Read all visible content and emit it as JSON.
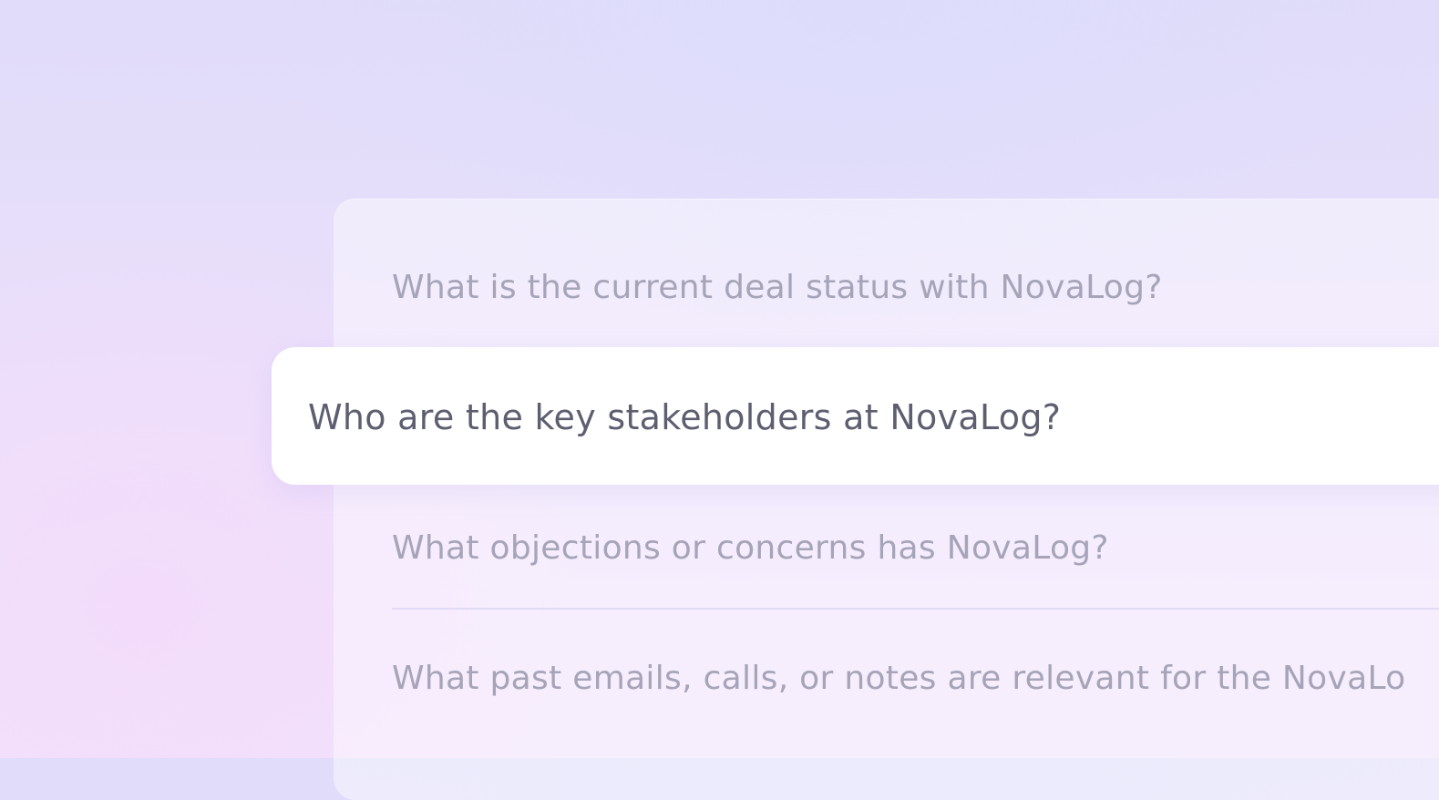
{
  "suggestions": [
    {
      "text": "What is the current deal status with NovaLog?"
    },
    {
      "text": "Who are the key stakeholders at NovaLog?"
    },
    {
      "text": "What objections or concerns has NovaLog?"
    },
    {
      "text": "What past emails, calls, or notes are relevant for the NovaLo"
    }
  ],
  "highlighted_index": 1,
  "colors": {
    "highlight_bg": "#ffffff",
    "highlight_text": "#5d5f70",
    "muted_text": "#a6a4b8"
  }
}
